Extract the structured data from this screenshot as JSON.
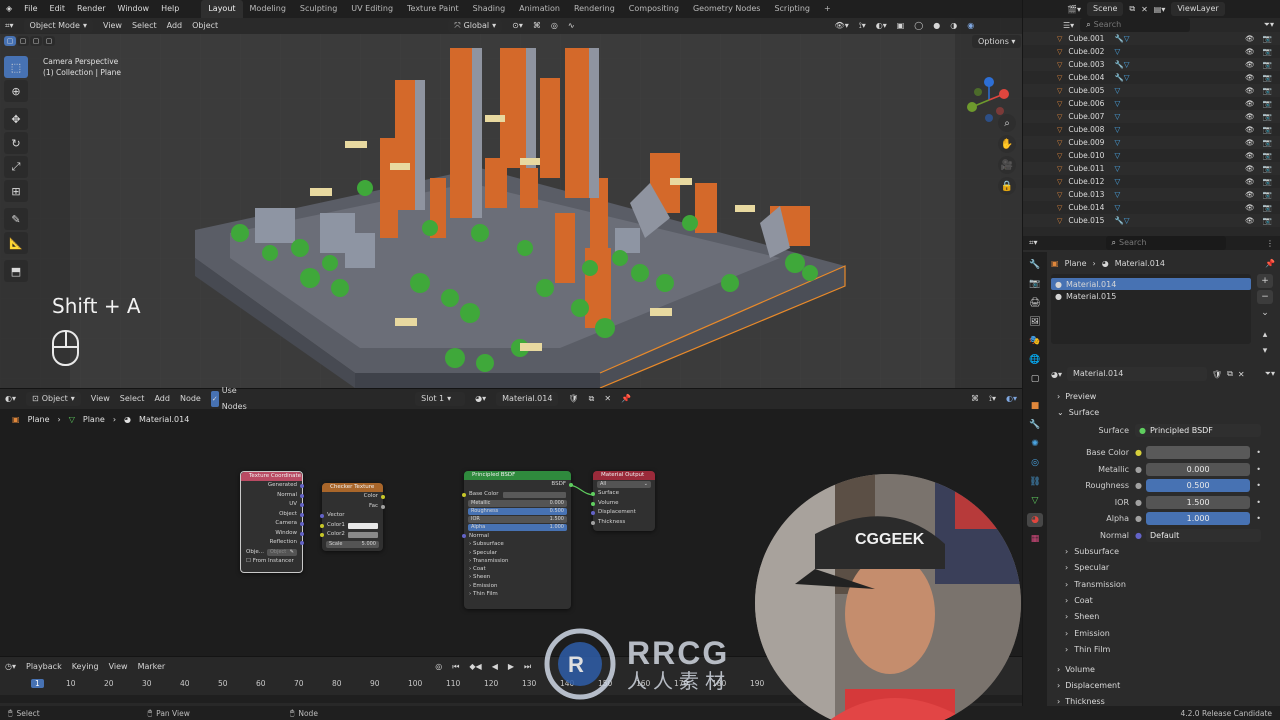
{
  "menubar": {
    "items": [
      "File",
      "Edit",
      "Render",
      "Window",
      "Help"
    ],
    "workspaces": [
      "Layout",
      "Modeling",
      "Sculpting",
      "UV Editing",
      "Texture Paint",
      "Shading",
      "Animation",
      "Rendering",
      "Compositing",
      "Geometry Nodes",
      "Scripting"
    ],
    "active_workspace": "Layout",
    "scene": "Scene",
    "view_layer": "ViewLayer"
  },
  "viewport": {
    "mode": "Object Mode",
    "menus": [
      "View",
      "Select",
      "Add",
      "Object"
    ],
    "transform_orientation": "Global",
    "options_label": "Options",
    "camera_line1": "Camera Perspective",
    "camera_line2": "(1) Collection | Plane",
    "shortcut_text": "Shift + A"
  },
  "outliner": {
    "search_placeholder": "Search",
    "rows": [
      "Cube.001",
      "Cube.002",
      "Cube.003",
      "Cube.004",
      "Cube.005",
      "Cube.006",
      "Cube.007",
      "Cube.008",
      "Cube.009",
      "Cube.010",
      "Cube.011",
      "Cube.012",
      "Cube.013",
      "Cube.014",
      "Cube.015"
    ]
  },
  "properties": {
    "search_placeholder": "Search",
    "breadcrumb_object": "Plane",
    "breadcrumb_material": "Material.014",
    "slots": [
      "Material.014",
      "Material.015"
    ],
    "material_name": "Material.014",
    "sections": {
      "preview": "Preview",
      "surface": "Surface"
    },
    "surface_label": "Surface",
    "surface_value": "Principled BSDF",
    "fields": [
      {
        "label": "Base Color",
        "value": ""
      },
      {
        "label": "Metallic",
        "value": "0.000"
      },
      {
        "label": "Roughness",
        "value": "0.500"
      },
      {
        "label": "IOR",
        "value": "1.500"
      },
      {
        "label": "Alpha",
        "value": "1.000"
      },
      {
        "label": "Normal",
        "value": "Default"
      }
    ],
    "subsections": [
      "Subsurface",
      "Specular",
      "Transmission",
      "Coat",
      "Sheen",
      "Emission",
      "Thin Film"
    ],
    "bottom_sections": [
      "Volume",
      "Displacement",
      "Thickness"
    ]
  },
  "node_editor": {
    "object_type": "Object",
    "menus": [
      "View",
      "Select",
      "Add",
      "Node"
    ],
    "use_nodes": "Use Nodes",
    "slot": "Slot 1",
    "material": "Material.014",
    "breadcrumb": [
      "Plane",
      "Plane",
      "Material.014"
    ],
    "texcoord": {
      "title": "Texture Coordinate",
      "outputs": [
        "Generated",
        "Normal",
        "UV",
        "Object",
        "Camera",
        "Window",
        "Reflection"
      ],
      "object_label": "Obje...",
      "object_placeholder": "Object",
      "from_instancer": "From Instancer"
    },
    "checker": {
      "title": "Checker Texture",
      "outputs": [
        "Color",
        "Fac"
      ],
      "inputs": [
        "Vector",
        "Color1",
        "Color2"
      ],
      "scale_label": "Scale",
      "scale_value": "5.000"
    },
    "bsdf": {
      "title": "Principled BSDF",
      "output": "BSDF",
      "base_color": "Base Color",
      "fields": [
        {
          "label": "Metallic",
          "value": "0.000"
        },
        {
          "label": "Roughness",
          "value": "0.500"
        },
        {
          "label": "IOR",
          "value": "1.500"
        },
        {
          "label": "Alpha",
          "value": "1.000"
        }
      ],
      "normal": "Normal",
      "panels": [
        "Subsurface",
        "Specular",
        "Transmission",
        "Coat",
        "Sheen",
        "Emission",
        "Thin Film"
      ]
    },
    "output": {
      "title": "Material Output",
      "target": "All",
      "inputs": [
        "Surface",
        "Volume",
        "Displacement",
        "Thickness"
      ]
    }
  },
  "timeline": {
    "menus": [
      "Playback",
      "Keying",
      "View",
      "Marker"
    ],
    "current_frame": "1",
    "ticks": [
      "10",
      "20",
      "30",
      "40",
      "50",
      "60",
      "70",
      "80",
      "90",
      "100",
      "110",
      "120",
      "130",
      "140",
      "150",
      "160",
      "170",
      "180",
      "190"
    ],
    "end_value": "0"
  },
  "statusbar": {
    "items": [
      "Select",
      "Pan View",
      "Node"
    ],
    "version": "4.2.0 Release Candidate"
  },
  "overlay": {
    "webcam_cap_text": "CGGEEK",
    "watermark_main": "RRCG",
    "watermark_sub": "人人素材"
  },
  "colors": {
    "accent_blue": "#4772b3",
    "orange": "#d96a2b",
    "green": "#3fa83a"
  }
}
